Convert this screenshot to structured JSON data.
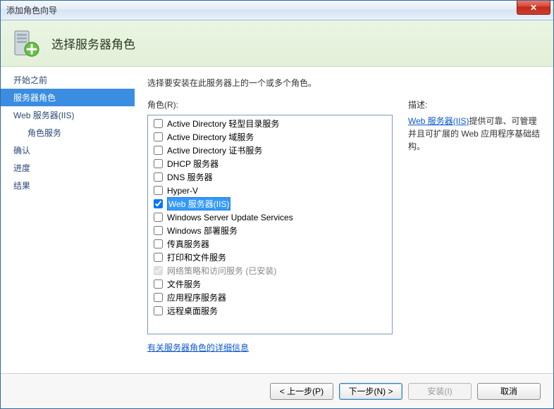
{
  "window": {
    "title": "添加角色向导"
  },
  "header": {
    "title": "选择服务器角色"
  },
  "nav": {
    "items": [
      {
        "label": "开始之前",
        "indent": false,
        "active": false
      },
      {
        "label": "服务器角色",
        "indent": false,
        "active": true
      },
      {
        "label": "Web 服务器(IIS)",
        "indent": false,
        "active": false
      },
      {
        "label": "角色服务",
        "indent": true,
        "active": false
      },
      {
        "label": "确认",
        "indent": false,
        "active": false
      },
      {
        "label": "进度",
        "indent": false,
        "active": false
      },
      {
        "label": "结果",
        "indent": false,
        "active": false
      }
    ]
  },
  "content": {
    "instruction": "选择要安装在此服务器上的一个或多个角色。",
    "roles_label": "角色(R):",
    "desc_label": "描述:",
    "more_link": "有关服务器角色的详细信息",
    "roles": [
      {
        "label": "Active Directory 轻型目录服务",
        "checked": false,
        "disabled": false,
        "selected": false
      },
      {
        "label": "Active Directory 域服务",
        "checked": false,
        "disabled": false,
        "selected": false
      },
      {
        "label": "Active Directory 证书服务",
        "checked": false,
        "disabled": false,
        "selected": false
      },
      {
        "label": "DHCP 服务器",
        "checked": false,
        "disabled": false,
        "selected": false
      },
      {
        "label": "DNS 服务器",
        "checked": false,
        "disabled": false,
        "selected": false
      },
      {
        "label": "Hyper-V",
        "checked": false,
        "disabled": false,
        "selected": false
      },
      {
        "label": "Web 服务器(IIS)",
        "checked": true,
        "disabled": false,
        "selected": true
      },
      {
        "label": "Windows Server Update Services",
        "checked": false,
        "disabled": false,
        "selected": false
      },
      {
        "label": "Windows 部署服务",
        "checked": false,
        "disabled": false,
        "selected": false
      },
      {
        "label": "传真服务器",
        "checked": false,
        "disabled": false,
        "selected": false
      },
      {
        "label": "打印和文件服务",
        "checked": false,
        "disabled": false,
        "selected": false
      },
      {
        "label": "网络策略和访问服务  (已安装)",
        "checked": true,
        "disabled": true,
        "selected": false
      },
      {
        "label": "文件服务",
        "checked": false,
        "disabled": false,
        "selected": false
      },
      {
        "label": "应用程序服务器",
        "checked": false,
        "disabled": false,
        "selected": false
      },
      {
        "label": "远程桌面服务",
        "checked": false,
        "disabled": false,
        "selected": false
      }
    ],
    "description": {
      "link_text": "Web 服务器(IIS)",
      "rest": "提供可靠、可管理并且可扩展的 Web 应用程序基础结构。"
    }
  },
  "footer": {
    "prev": "< 上一步(P)",
    "next": "下一步(N) >",
    "install": "安装(I)",
    "cancel": "取消"
  }
}
